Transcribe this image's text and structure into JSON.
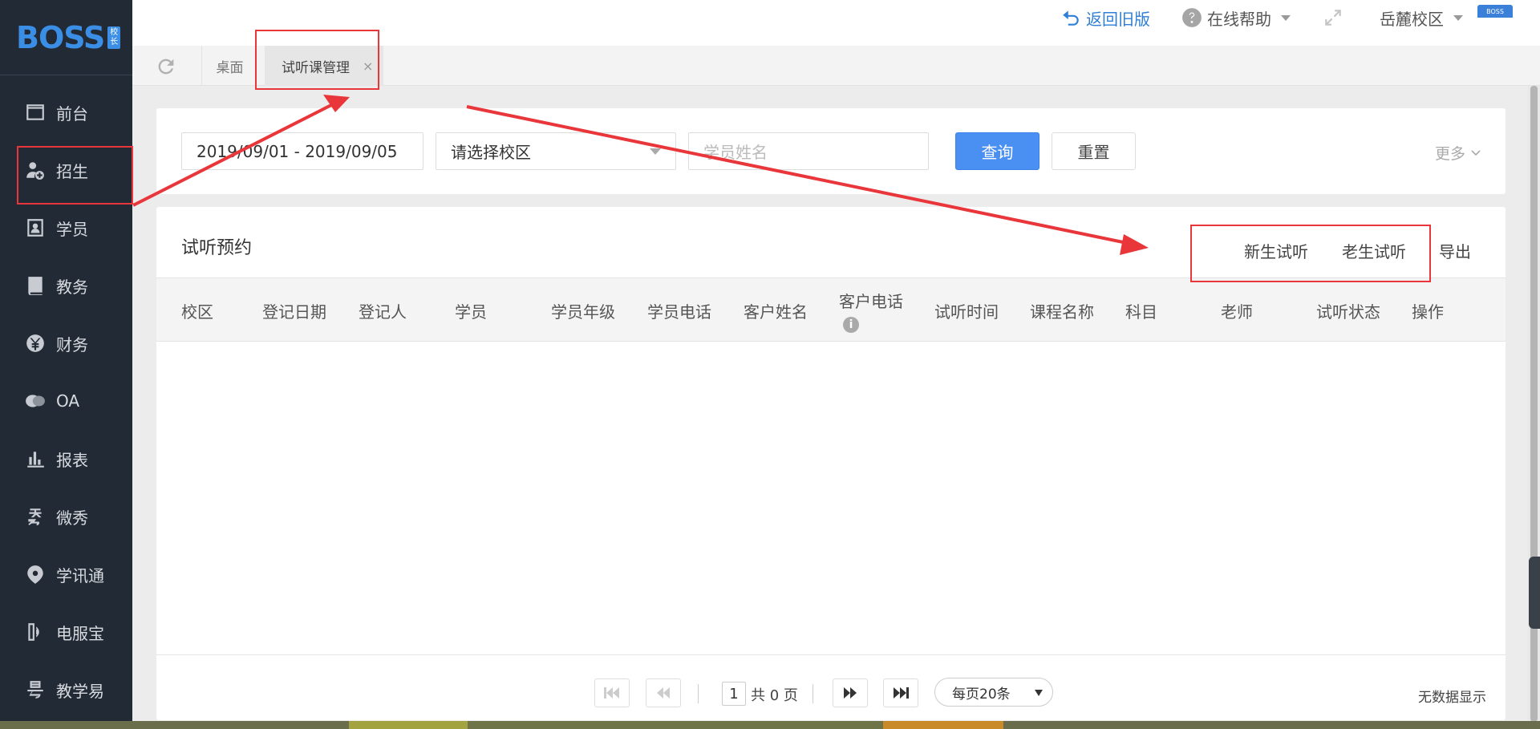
{
  "logo": {
    "text": "BOSS",
    "badge_top": "校",
    "badge_bottom": "长"
  },
  "sidebar": {
    "items": [
      {
        "label": "前台",
        "icon": "window-icon"
      },
      {
        "label": "招生",
        "icon": "user-add-icon"
      },
      {
        "label": "学员",
        "icon": "id-card-icon"
      },
      {
        "label": "教务",
        "icon": "book-icon"
      },
      {
        "label": "财务",
        "icon": "yen-icon"
      },
      {
        "label": "OA",
        "icon": "chat-bubbles-icon"
      },
      {
        "label": "报表",
        "icon": "bar-chart-icon"
      },
      {
        "label": "微秀",
        "icon": "xiu-icon"
      },
      {
        "label": "学讯通",
        "icon": "location-pin-icon"
      },
      {
        "label": "电服宝",
        "icon": "phone-service-icon"
      },
      {
        "label": "教学易",
        "icon": "jiao-icon"
      }
    ]
  },
  "header": {
    "back_old": "返回旧版",
    "help": "在线帮助",
    "campus": "岳麓校区",
    "avatar_text": "BOSS"
  },
  "tabs": {
    "desk": "桌面",
    "active": "试听课管理",
    "close": "×"
  },
  "filter": {
    "date_range": "2019/09/01 - 2019/09/05",
    "campus_select": "请选择校区",
    "name_placeholder": "学员姓名",
    "query": "查询",
    "reset": "重置",
    "more": "更多"
  },
  "table": {
    "title": "试听预约",
    "actions": {
      "new_trial": "新生试听",
      "old_trial": "老生试听",
      "export": "导出"
    },
    "columns": [
      "校区",
      "登记日期",
      "登记人",
      "学员",
      "学员年级",
      "学员电话",
      "客户姓名",
      "客户电话",
      "试听时间",
      "课程名称",
      "科目",
      "老师",
      "试听状态",
      "操作"
    ],
    "info_icon_text": "i"
  },
  "pagination": {
    "current_page": "1",
    "total": "共 0 页",
    "page_size": "每页20条",
    "empty": "无数据显示"
  },
  "colors": {
    "sidebar_bg": "#222a35",
    "primary": "#4a90f2",
    "annotation": "#e8363a",
    "link_blue": "#2f7fd6"
  }
}
